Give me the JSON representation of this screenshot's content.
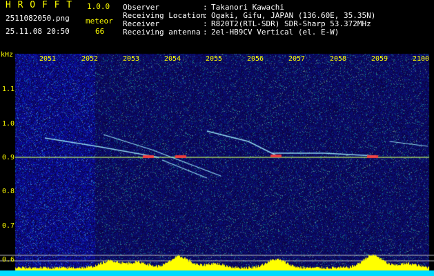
{
  "app": {
    "logo": "H R O F F T",
    "version": "1.0.0",
    "filename": "2511082050.png",
    "datetime": "25.11.08 20:50",
    "type_label": "meteor",
    "count": "66"
  },
  "info": {
    "rows": [
      {
        "key": "Observer",
        "sep": ":",
        "value": "Takanori Kawachi"
      },
      {
        "key": "Receiving Location",
        "sep": ":",
        "value": "Ogaki, Gifu, JAPAN (136.60E, 35.35N)"
      },
      {
        "key": "Receiver",
        "sep": ":",
        "value": "R820T2(RTL-SDR) SDR-Sharp 53.372MHz"
      },
      {
        "key": "Receiving antenna",
        "sep": ":",
        "value": "2el-HB9CV Vertical (el. E-W)"
      }
    ]
  },
  "axis": {
    "unit": "kHz",
    "x_ticks": [
      "2051",
      "2052",
      "2053",
      "2054",
      "2055",
      "2056",
      "2057",
      "2058",
      "2059",
      "2100"
    ],
    "y_ticks": [
      "1.1",
      "1.0",
      "0.9",
      "0.8",
      "0.7",
      "0.6"
    ]
  },
  "colors": {
    "background": "#000000",
    "noise": "#1a2d8c",
    "carrier": "#c8ff64",
    "trail": "#a0f0ff",
    "hot": "#ff3030",
    "activity": "#ffff00",
    "baseline": "#00dcff"
  }
}
